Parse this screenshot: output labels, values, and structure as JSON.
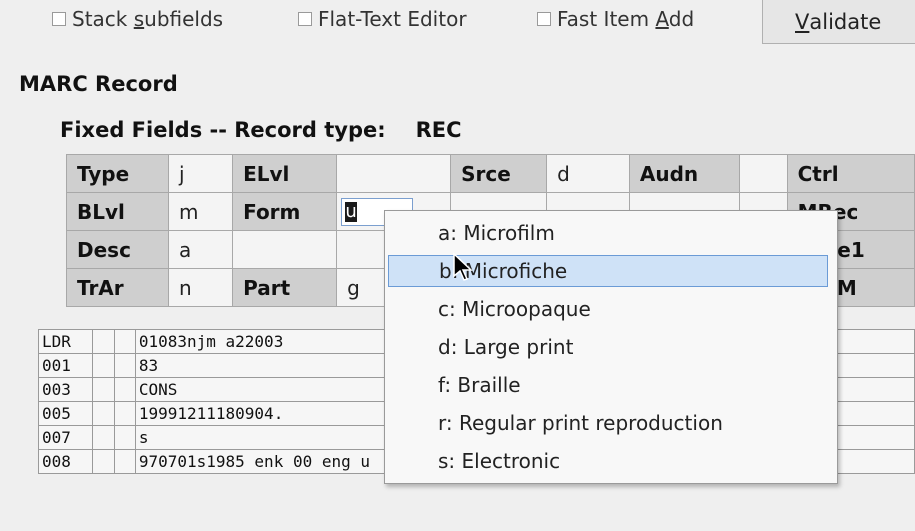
{
  "options": [
    {
      "pre": "Stack ",
      "ul": "s",
      "post": "ubfields"
    },
    {
      "pre": "Flat-Text Editor",
      "ul": "",
      "post": ""
    },
    {
      "pre": "Fast Item ",
      "ul": "A",
      "post": "dd"
    }
  ],
  "validate": {
    "ul": "V",
    "post": "alidate"
  },
  "marc_record_heading": "MARC Record",
  "fixed_fields_heading": "Fixed Fields -- Record type:",
  "record_type": "REC",
  "fixed_fields": [
    [
      {
        "t": "Type",
        "lbl": true
      },
      {
        "t": "j"
      },
      {
        "t": "ELvl",
        "lbl": true
      },
      {
        "t": ""
      },
      {
        "t": "Srce",
        "lbl": true
      },
      {
        "t": "d"
      },
      {
        "t": "Audn",
        "lbl": true
      },
      {
        "t": ""
      },
      {
        "t": "Ctrl",
        "lbl": true
      }
    ],
    [
      {
        "t": "BLvl",
        "lbl": true
      },
      {
        "t": "m"
      },
      {
        "t": "Form",
        "lbl": true
      },
      {
        "t": "u",
        "input": true
      },
      {
        "t": ""
      },
      {
        "t": ""
      },
      {
        "t": ""
      },
      {
        "t": ""
      },
      {
        "t": "MRec",
        "lbl": true
      }
    ],
    [
      {
        "t": "Desc",
        "lbl": true
      },
      {
        "t": "a"
      },
      {
        "t": ""
      },
      {
        "t": ""
      },
      {
        "t": ""
      },
      {
        "t": ""
      },
      {
        "t": ""
      },
      {
        "t": ""
      },
      {
        "t": "Date1",
        "lbl": true
      }
    ],
    [
      {
        "t": "TrAr",
        "lbl": true
      },
      {
        "t": "n"
      },
      {
        "t": "Part",
        "lbl": true
      },
      {
        "t": "g"
      },
      {
        "t": ""
      },
      {
        "t": ""
      },
      {
        "t": ""
      },
      {
        "t": ""
      },
      {
        "t": "AccM",
        "lbl": true
      }
    ]
  ],
  "marc_rows": [
    {
      "tag": "LDR",
      "value": "01083njm a22003"
    },
    {
      "tag": "001",
      "value": "83"
    },
    {
      "tag": "003",
      "value": "CONS"
    },
    {
      "tag": "005",
      "value": "19991211180904."
    },
    {
      "tag": "007",
      "value": "s"
    },
    {
      "tag": "008",
      "value": "970701s1985 enk 00 eng u"
    }
  ],
  "dropdown": {
    "items": [
      "a: Microfilm",
      "b: Microfiche",
      "c: Microopaque",
      "d: Large print",
      "f: Braille",
      "r: Regular print reproduction",
      "s: Electronic"
    ],
    "highlighted_index": 1
  }
}
